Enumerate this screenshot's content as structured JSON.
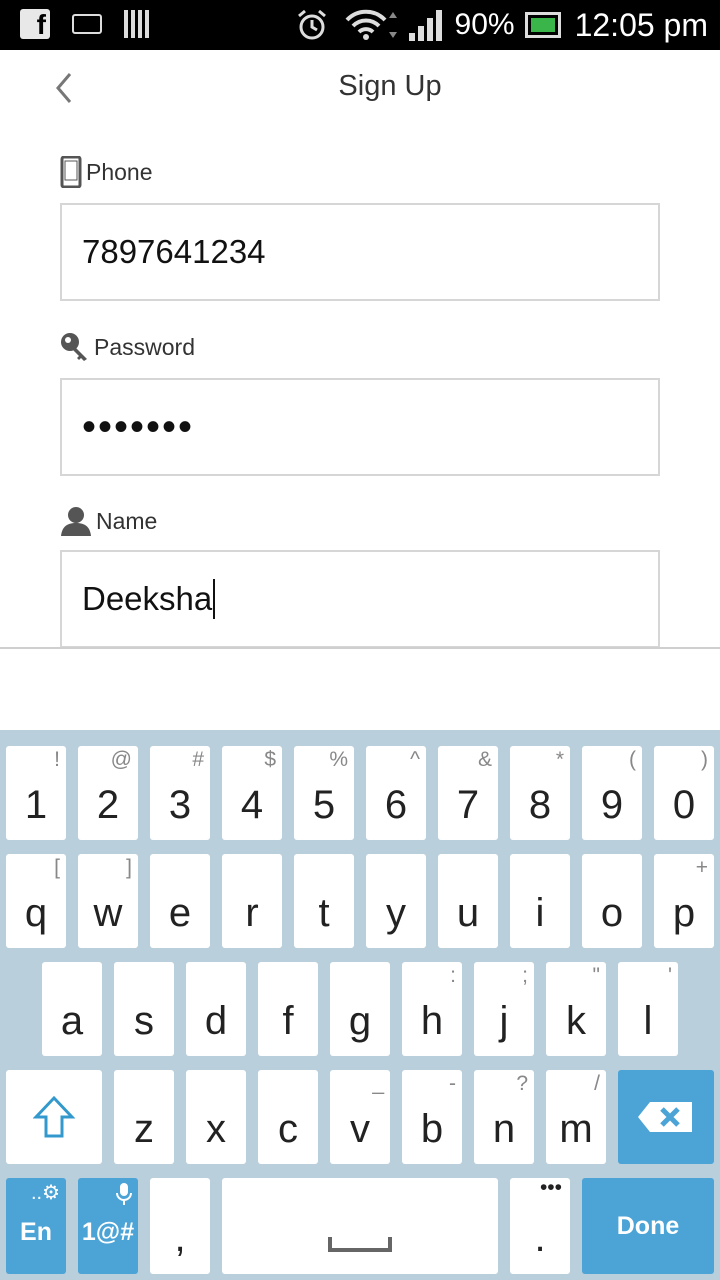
{
  "status_bar": {
    "battery": "90%",
    "time": "12:05 pm",
    "icons": [
      "facebook-icon",
      "keyboard-icon",
      "barcode-icon",
      "alarm-icon",
      "wifi-icon",
      "signal-icon",
      "battery-charging-icon"
    ]
  },
  "header": {
    "title": "Sign Up",
    "back_icon": "chevron-left-icon"
  },
  "form": {
    "phone": {
      "label": "Phone",
      "value": "7897641234",
      "icon": "phone-icon"
    },
    "password": {
      "label": "Password",
      "value": "•••••••",
      "icon": "key-icon"
    },
    "name": {
      "label": "Name",
      "value": "Deeksha",
      "icon": "person-icon"
    }
  },
  "keyboard": {
    "row1": [
      {
        "main": "1",
        "sec": "!"
      },
      {
        "main": "2",
        "sec": "@"
      },
      {
        "main": "3",
        "sec": "#"
      },
      {
        "main": "4",
        "sec": "$"
      },
      {
        "main": "5",
        "sec": "%"
      },
      {
        "main": "6",
        "sec": "^"
      },
      {
        "main": "7",
        "sec": "&"
      },
      {
        "main": "8",
        "sec": "*"
      },
      {
        "main": "9",
        "sec": "("
      },
      {
        "main": "0",
        "sec": ")"
      }
    ],
    "row2": [
      {
        "main": "q",
        "sec": "["
      },
      {
        "main": "w",
        "sec": "]"
      },
      {
        "main": "e",
        "sec": ""
      },
      {
        "main": "r",
        "sec": ""
      },
      {
        "main": "t",
        "sec": ""
      },
      {
        "main": "y",
        "sec": ""
      },
      {
        "main": "u",
        "sec": ""
      },
      {
        "main": "i",
        "sec": ""
      },
      {
        "main": "o",
        "sec": ""
      },
      {
        "main": "p",
        "sec": "+"
      }
    ],
    "row3": [
      {
        "main": "a",
        "sec": ""
      },
      {
        "main": "s",
        "sec": ""
      },
      {
        "main": "d",
        "sec": ""
      },
      {
        "main": "f",
        "sec": ""
      },
      {
        "main": "g",
        "sec": ""
      },
      {
        "main": "h",
        "sec": ":"
      },
      {
        "main": "j",
        "sec": ";"
      },
      {
        "main": "k",
        "sec": "\""
      },
      {
        "main": "l",
        "sec": "'"
      }
    ],
    "row4": [
      {
        "main": "z",
        "sec": ""
      },
      {
        "main": "x",
        "sec": ""
      },
      {
        "main": "c",
        "sec": ""
      },
      {
        "main": "v",
        "sec": "_"
      },
      {
        "main": "b",
        "sec": "-"
      },
      {
        "main": "n",
        "sec": "?"
      },
      {
        "main": "m",
        "sec": "/"
      }
    ],
    "lang_label": "En",
    "lang_sec": "..⚙",
    "symbols_label": "1@#",
    "comma": ",",
    "period": ".",
    "period_sec": "•••",
    "done_label": "Done",
    "colors": {
      "background": "#b9cfdc",
      "key": "#ffffff",
      "accent": "#4ba3d6"
    }
  }
}
